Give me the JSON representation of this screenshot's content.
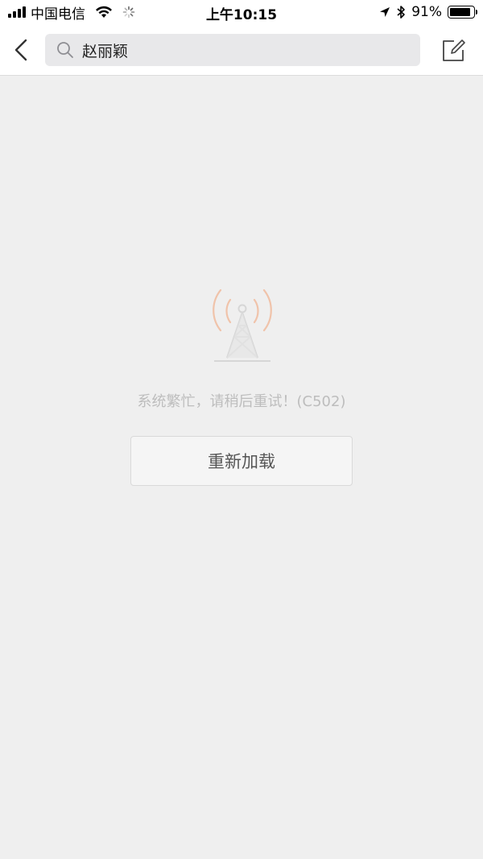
{
  "status_bar": {
    "carrier": "中国电信",
    "time": "上午10:15",
    "battery_percent": "91%",
    "battery_level": 0.91
  },
  "nav": {
    "search_value": "赵丽颖"
  },
  "main": {
    "error_message": "系统繁忙，请稍后重试！(C502)",
    "reload_label": "重新加载"
  },
  "colors": {
    "background": "#efefef",
    "tower_signal": "#f2c2a8",
    "tower_body": "#d8d8d8"
  }
}
